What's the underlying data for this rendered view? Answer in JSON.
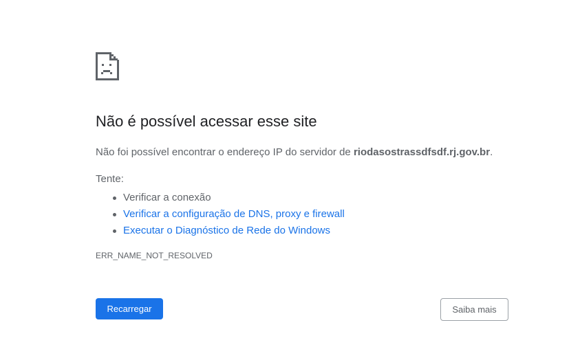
{
  "error": {
    "title": "Não é possível acessar esse site",
    "description_prefix": "Não foi possível encontrar o endereço IP do servidor de ",
    "hostname": "riodasostrassdfsdf.rj.gov.br",
    "description_suffix": ".",
    "try_label": "Tente:",
    "suggestions": [
      {
        "text": "Verificar a conexão",
        "is_link": false
      },
      {
        "text": "Verificar a configuração de DNS, proxy e firewall",
        "is_link": true
      },
      {
        "text": "Executar o Diagnóstico de Rede do Windows",
        "is_link": true
      }
    ],
    "code": "ERR_NAME_NOT_RESOLVED"
  },
  "buttons": {
    "reload_label": "Recarregar",
    "details_label": "Saiba mais"
  },
  "colors": {
    "accent": "#1a73e8",
    "text": "#5f6368",
    "title": "#202124"
  },
  "icons": {
    "error_icon": "sad-page-icon"
  }
}
